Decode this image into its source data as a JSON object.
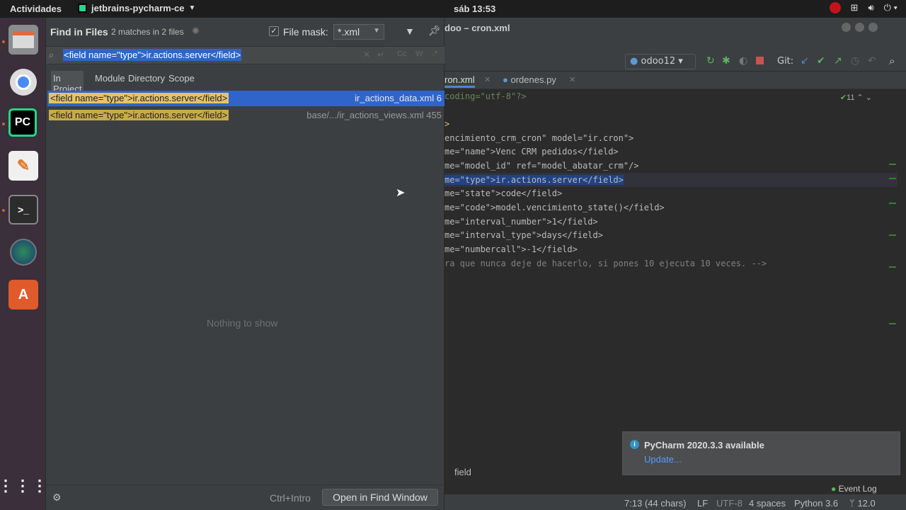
{
  "topbar": {
    "activities": "Actividades",
    "app_name": "jetbrains-pycharm-ce",
    "app_menu_icon": "chevron-down-icon",
    "clock": "sáb 13:53"
  },
  "dock": {
    "items": [
      "files-icon",
      "chromium-icon",
      "pycharm-icon",
      "text-editor-icon",
      "terminal-icon",
      "browser-globe-icon",
      "software-center-icon"
    ],
    "pycharm_label": "PC",
    "show_apps_icon": "grid-icon"
  },
  "ide": {
    "title": "doo – cron.xml",
    "run_config": "odoo12",
    "git_label": "Git:",
    "tabs": [
      {
        "label": "ron.xml",
        "active": true
      },
      {
        "label": "ordenes.py",
        "active": false
      }
    ],
    "inspection_count": "11",
    "code_lines": [
      {
        "t": "coding=\"utf-8\"?>"
      },
      {
        "t": ""
      },
      {
        "t": ">"
      },
      {
        "t": "encimiento_crm_cron\" model=\"ir.cron\">"
      },
      {
        "t": "me=\"name\">Venc CRM pedidos</field>"
      },
      {
        "t": "me=\"model_id\" ref=\"model_abatar_crm\"/>"
      },
      {
        "t": "me=\"type\">ir.actions.server</field>"
      },
      {
        "t": "me=\"state\">code</field>"
      },
      {
        "t": "me=\"code\">model.vencimiento_state()</field>"
      },
      {
        "t": "me=\"interval_number\">1</field>"
      },
      {
        "t": "me=\"interval_type\">days</field>"
      },
      {
        "t": "me=\"numbercall\">-1</field>"
      },
      {
        "t": "ra que nunca deje de hacerlo, si pones 10 ejecuta 10 veces. -->"
      }
    ],
    "breadcrumb": "field",
    "notification": {
      "title": "PyCharm 2020.3.3 available",
      "link": "Update..."
    },
    "event_log": "Event Log",
    "status": {
      "position": "7:13 (44 chars)",
      "line_sep": "LF",
      "encoding": "UTF-8",
      "indent": "4 spaces",
      "interpreter": "Python 3.6",
      "vcs": "12.0"
    }
  },
  "find": {
    "title": "Find in Files",
    "match_count": "2 matches in 2 files",
    "file_mask_label": "File mask:",
    "file_mask_checked": true,
    "file_mask_value": "*.xml",
    "query": "<field name=\"type\">ir.actions.server</field>",
    "scopes": [
      "In Project",
      "Module",
      "Directory",
      "Scope"
    ],
    "active_scope": "In Project",
    "results": [
      {
        "match": "<field name=\"type\">ir.actions.server</field>",
        "file": "ir_actions_data.xml 6",
        "selected": true
      },
      {
        "match": "<field name=\"type\">ir.actions.server</field>",
        "file": "base/.../ir_actions_views.xml 455",
        "selected": false
      }
    ],
    "preview_empty": "Nothing to show",
    "shortcut": "Ctrl+Intro",
    "open_button": "Open in Find Window",
    "case_toggle": "Cc",
    "word_toggle": "W"
  }
}
